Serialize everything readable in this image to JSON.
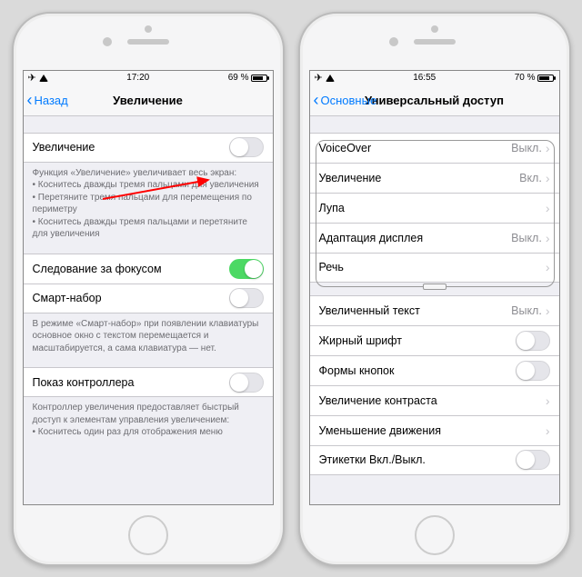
{
  "left": {
    "status": {
      "time": "17:20",
      "battery": "69 %",
      "airplane": "✈"
    },
    "nav": {
      "back": "Назад",
      "title": "Увеличение"
    },
    "row_zoom": "Увеличение",
    "footer1_head": "Функция «Увеличение» увеличивает весь экран:",
    "footer1_items": [
      "Коснитесь дважды тремя пальцами для увеличения",
      "Перетяните тремя пальцами для перемещения по периметру",
      "Коснитесь дважды тремя пальцами и перетяните для увеличения"
    ],
    "row_follow": "Следование за фокусом",
    "row_smart": "Смарт-набор",
    "footer2": "В режиме «Смарт-набор» при появлении клавиатуры основное окно с текстом перемещается и масштабируется, а сама клавиатура — нет.",
    "row_controller": "Показ контроллера",
    "footer3_head": "Контроллер увеличения предоставляет быстрый доступ к элементам управления увеличением:",
    "footer3_items": [
      "Коснитесь один раз для отображения меню"
    ]
  },
  "right": {
    "status": {
      "time": "16:55",
      "battery": "70 %",
      "airplane": "✈"
    },
    "nav": {
      "back": "Основные",
      "title": "Универсальный доступ"
    },
    "g1": [
      {
        "label": "VoiceOver",
        "value": "Выкл."
      },
      {
        "label": "Увеличение",
        "value": "Вкл."
      },
      {
        "label": "Лупа",
        "value": ""
      },
      {
        "label": "Адаптация дисплея",
        "value": "Выкл."
      },
      {
        "label": "Речь",
        "value": ""
      }
    ],
    "g2": [
      {
        "label": "Увеличенный текст",
        "value": "Выкл.",
        "type": "nav"
      },
      {
        "label": "Жирный шрифт",
        "type": "toggle",
        "on": false
      },
      {
        "label": "Формы кнопок",
        "type": "toggle",
        "on": false
      },
      {
        "label": "Увеличение контраста",
        "type": "nav"
      },
      {
        "label": "Уменьшение движения",
        "type": "nav"
      },
      {
        "label": "Этикетки Вкл./Выкл.",
        "type": "toggle",
        "on": false
      }
    ]
  }
}
